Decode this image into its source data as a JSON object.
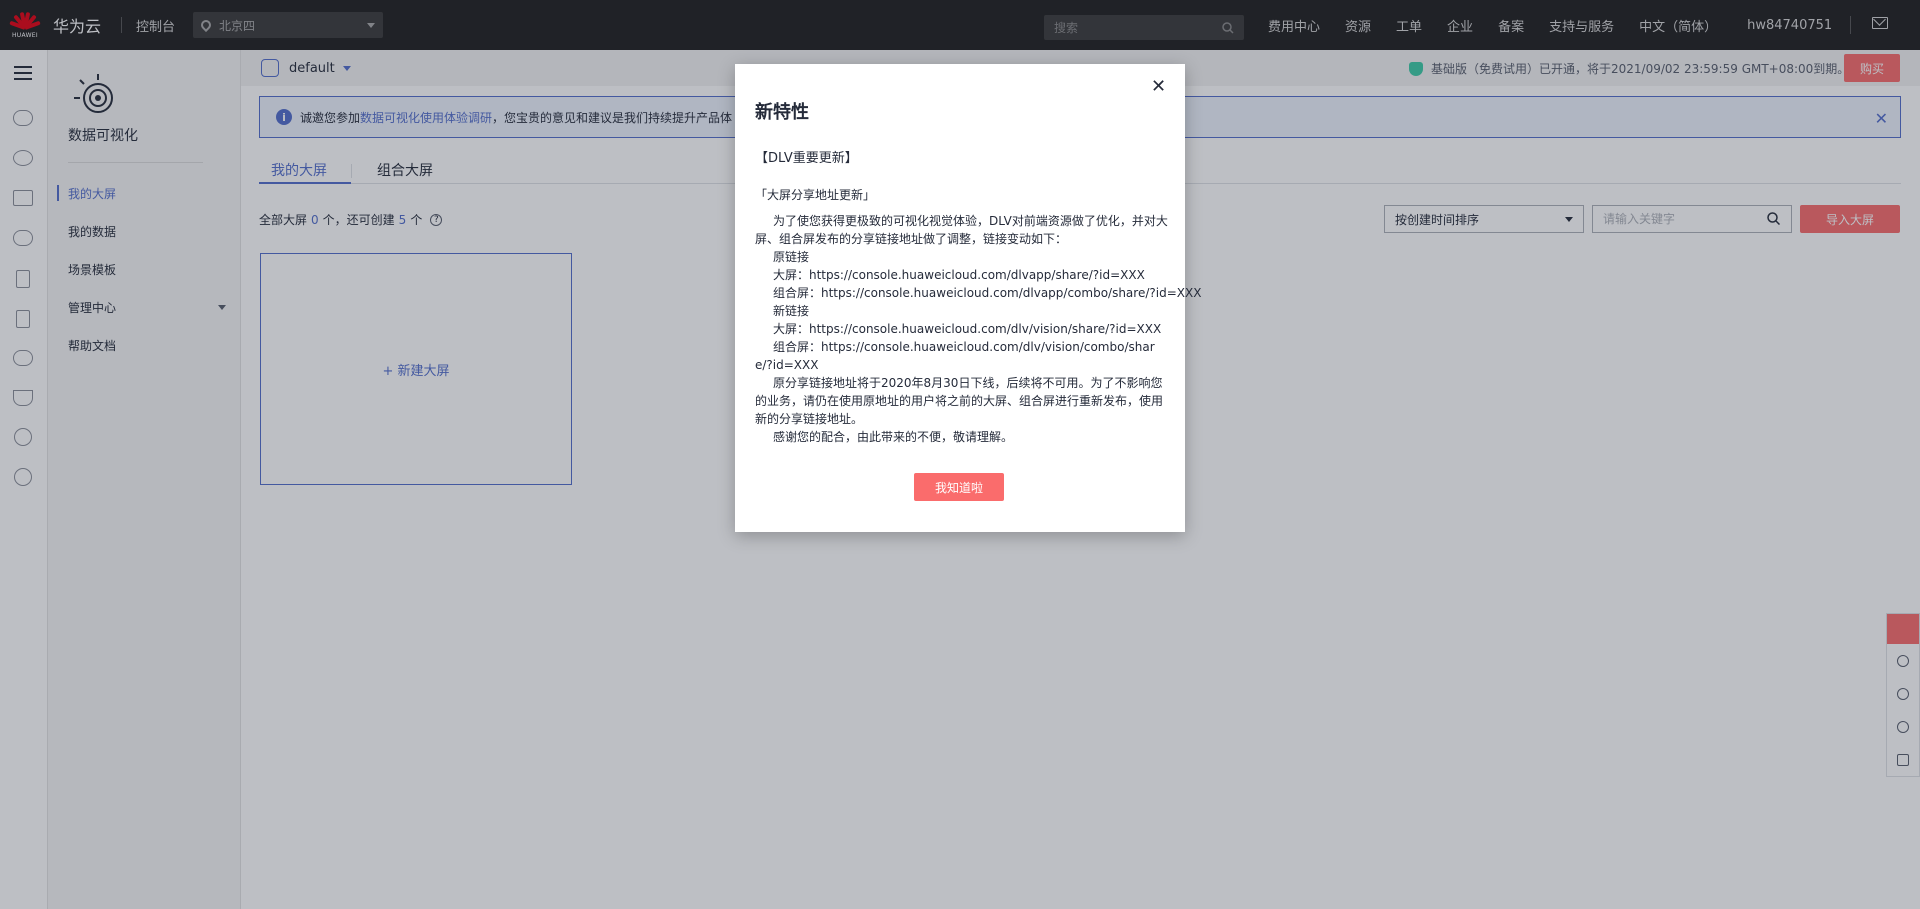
{
  "topbar": {
    "logo_text": "HUAWEI",
    "brand": "华为云",
    "console": "控制台",
    "region": "北京四",
    "search_placeholder": "搜索",
    "nav": [
      "费用中心",
      "资源",
      "工单",
      "企业",
      "备案",
      "支持与服务",
      "中文（简体）",
      "hw84740751"
    ]
  },
  "sidebar": {
    "title": "数据可视化",
    "items": [
      {
        "label": "我的大屏",
        "active": true
      },
      {
        "label": "我的数据",
        "active": false
      },
      {
        "label": "场景模板",
        "active": false
      },
      {
        "label": "管理中心",
        "active": false
      },
      {
        "label": "帮助文档",
        "active": false
      }
    ]
  },
  "project": {
    "name": "default"
  },
  "trial": {
    "text": "基础版（免费试用）已开通，将于2021/09/02 23:59:59 GMT+08:00到期。",
    "buy": "购买"
  },
  "notice": {
    "prefix": "诚邀您参加",
    "link": "数据可视化使用体验调研",
    "suffix": "，您宝贵的意见和建议是我们持续提升产品体"
  },
  "tabs": [
    "我的大屏",
    "组合大屏"
  ],
  "counts": {
    "label_all": "全部大屏",
    "total": "0",
    "unit1": "个，还可创建",
    "remaining": "5",
    "unit2": "个"
  },
  "toolbar": {
    "sort": "按创建时间排序",
    "keyword_placeholder": "请输入关键字",
    "import": "导入大屏"
  },
  "new_card": {
    "label": "+ 新建大屏"
  },
  "modal": {
    "title": "新特性",
    "head": "【DLV重要更新】",
    "sub": "「大屏分享地址更新」",
    "intro": "为了使您获得更极致的可视化视觉体验，DLV对前端资源做了优化，并对大屏、组合屏发布的分享链接地址做了调整，链接变动如下：",
    "old_label": "原链接",
    "old_screen": "大屏：https://console.huaweicloud.com/dlvapp/share/?id=XXX",
    "old_combo": "组合屏：https://console.huaweicloud.com/dlvapp/combo/share/?id=XXX",
    "new_label": "新链接",
    "new_screen": "大屏：https://console.huaweicloud.com/dlv/vision/share/?id=XXX",
    "new_combo": "组合屏：https://console.huaweicloud.com/dlv/vision/combo/share/?id=XXX",
    "deprecate": "原分享链接地址将于2020年8月30日下线，后续将不可用。为了不影响您的业务，请仍在使用原地址的用户将之前的大屏、组合屏进行重新发布，使用新的分享链接地址。",
    "thanks": "感谢您的配合，由此带来的不便，敬请理解。",
    "button": "我知道啦"
  },
  "colors": {
    "accent": "#526ecc",
    "danger": "#fa6c6c",
    "topbar": "#1f1f1f"
  }
}
